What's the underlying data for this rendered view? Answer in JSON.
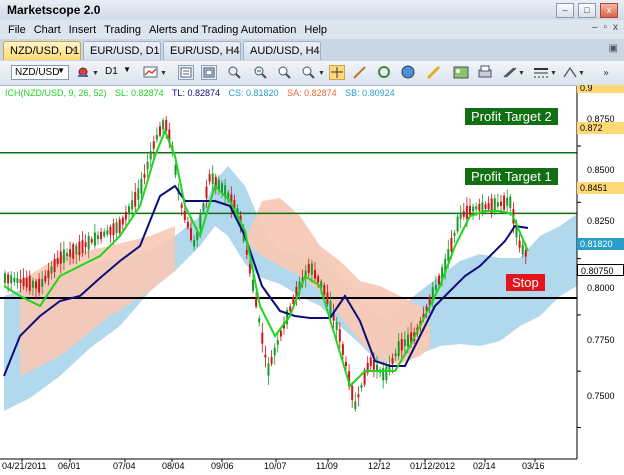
{
  "app": {
    "title": "Marketscope 2.0"
  },
  "window_controls": {
    "minimize": "–",
    "maximize": "□",
    "close": "x"
  },
  "menu": {
    "items": [
      "File",
      "Chart",
      "Insert",
      "Trading",
      "Alerts and Trading Automation",
      "Help"
    ]
  },
  "menu_controls": {
    "minimize": "–",
    "restore": "▫",
    "close": "x"
  },
  "tabs": [
    {
      "label": "NZD/USD, D1",
      "active": true,
      "close": "×"
    },
    {
      "label": "EUR/USD, D1",
      "active": false
    },
    {
      "label": "EUR/USD, H4",
      "active": false
    },
    {
      "label": "AUD/USD, H4",
      "active": false
    }
  ],
  "toolbar": {
    "symbol": "NZD/USD",
    "timeframe": "D1"
  },
  "indicator": {
    "name": "ICH(NZD/USD, 9, 26, 52)",
    "sl": "SL: 0.82874",
    "tl": "TL: 0.82874",
    "cs": "CS: 0.81820",
    "sa": "SA: 0.82874",
    "sb": "SB: 0.80924"
  },
  "annotations": {
    "profit_target_2": "Profit Target 2",
    "profit_target_1": "Profit Target 1",
    "stop": "Stop"
  },
  "colors": {
    "target": "#126e12",
    "stop": "#e3141b",
    "kumo_up": "#a9d4ea",
    "kumo_down": "#f8c9b6",
    "kijun": "#0d0d7a",
    "tenkan": "#1ed61e"
  },
  "chart_data": {
    "type": "candlestick",
    "price_labels": [
      "0.8750",
      "0.8500",
      "0.8250",
      "0.8000",
      "0.7750",
      "0.7500"
    ],
    "top_clipped_label": "0.9",
    "level_labels": {
      "target2": "0.872",
      "target1": "0.8451",
      "current": "0.81820",
      "stop": "0.80750"
    },
    "x_labels": [
      "04/21/2011",
      "06/01",
      "07/04",
      "08/04",
      "09/06",
      "10/07",
      "11/09",
      "12/12",
      "01/12/2012",
      "02/14",
      "03/16"
    ],
    "ylim": [
      0.736,
      0.895
    ],
    "levels": {
      "target2": 0.872,
      "target1": 0.8451,
      "stop": 0.8075,
      "current": 0.8182
    }
  }
}
